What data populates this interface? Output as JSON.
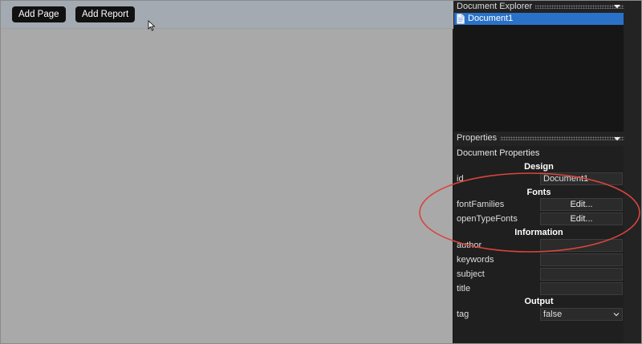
{
  "toolbar": {
    "add_page_label": "Add Page",
    "add_report_label": "Add Report"
  },
  "document_explorer": {
    "title": "Document Explorer",
    "items": [
      {
        "label": "Document1",
        "selected": true
      }
    ]
  },
  "properties": {
    "title": "Properties",
    "heading": "Document Properties",
    "sections": {
      "design": "Design",
      "fonts": "Fonts",
      "information": "Information",
      "output": "Output"
    },
    "rows": {
      "id": {
        "name": "id",
        "value": "Document1"
      },
      "fontFamilies": {
        "name": "fontFamilies",
        "value": "Edit..."
      },
      "openTypeFonts": {
        "name": "openTypeFonts",
        "value": "Edit..."
      },
      "author": {
        "name": "author",
        "value": ""
      },
      "keywords": {
        "name": "keywords",
        "value": ""
      },
      "subject": {
        "name": "subject",
        "value": ""
      },
      "title": {
        "name": "title",
        "value": ""
      },
      "tag": {
        "name": "tag",
        "value": "false"
      }
    }
  },
  "colors": {
    "selection": "#2a72c8",
    "annotation": "#d9453c",
    "canvas": "#a9a9a9"
  },
  "icons": [
    "cursor-arrow-icon",
    "document-icon",
    "chevron-down-icon"
  ]
}
